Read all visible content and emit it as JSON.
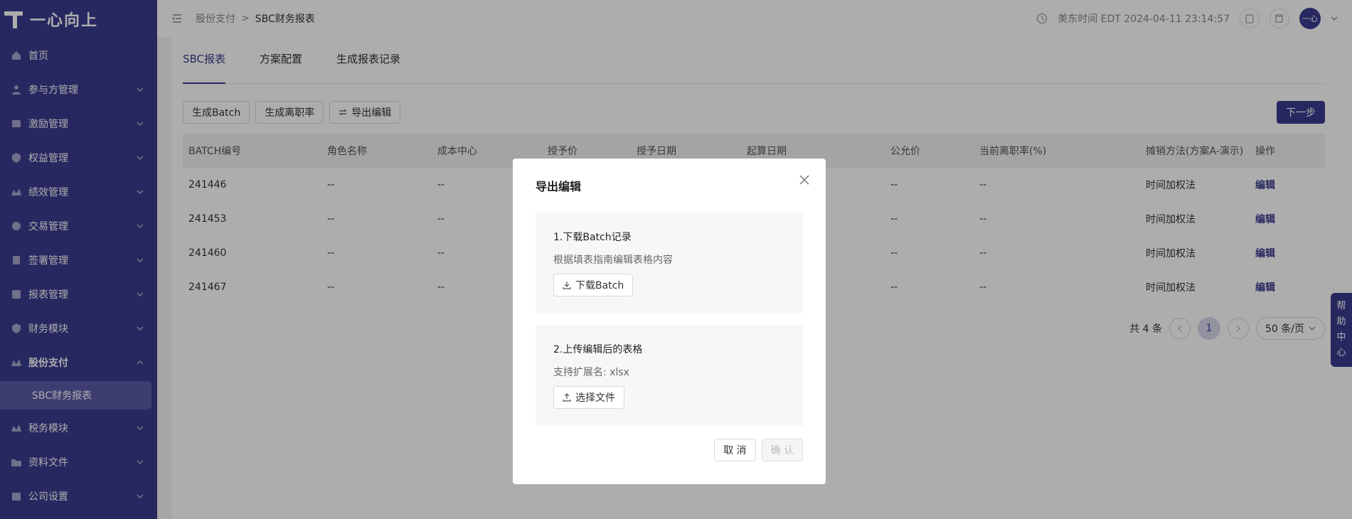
{
  "app": {
    "logo_text": "一心向上"
  },
  "sidebar": {
    "items": [
      {
        "label": "首页"
      },
      {
        "label": "参与方管理"
      },
      {
        "label": "激励管理"
      },
      {
        "label": "权益管理"
      },
      {
        "label": "绩效管理"
      },
      {
        "label": "交易管理"
      },
      {
        "label": "签署管理"
      },
      {
        "label": "报表管理"
      },
      {
        "label": "财务模块"
      },
      {
        "label": "股份支付"
      },
      {
        "label": "税务模块"
      },
      {
        "label": "资料文件"
      },
      {
        "label": "公司设置"
      }
    ],
    "sub_active": "SBC财务报表"
  },
  "header": {
    "breadcrumb_parent": "股份支付",
    "breadcrumb_sep": ">",
    "breadcrumb_current": "SBC财务报表",
    "time_text": "美东时间 EDT 2024-04-11 23:14:57",
    "avatar_text": "一心"
  },
  "tabs": [
    {
      "label": "SBC报表",
      "active": true
    },
    {
      "label": "方案配置",
      "active": false
    },
    {
      "label": "生成报表记录",
      "active": false
    }
  ],
  "toolbar": {
    "gen_batch": "生成Batch",
    "gen_rate": "生成离职率",
    "export_edit": "导出编辑",
    "next": "下一步"
  },
  "table": {
    "columns": [
      "BATCH编号",
      "角色名称",
      "成本中心",
      "授予价",
      "授予日期",
      "起算日期",
      "公允价",
      "当前离职率(%)",
      "摊销方法(方案A-演示)",
      "操作"
    ],
    "rows": [
      {
        "batch": "241446",
        "role": "--",
        "cost": "--",
        "fair": "--",
        "rate": "--",
        "method": "时间加权法",
        "action": "编辑"
      },
      {
        "batch": "241453",
        "role": "--",
        "cost": "--",
        "fair": "--",
        "rate": "--",
        "method": "时间加权法",
        "action": "编辑"
      },
      {
        "batch": "241460",
        "role": "--",
        "cost": "--",
        "fair": "--",
        "rate": "--",
        "method": "时间加权法",
        "action": "编辑"
      },
      {
        "batch": "241467",
        "role": "--",
        "cost": "--",
        "fair": "--",
        "rate": "--",
        "method": "时间加权法",
        "action": "编辑"
      }
    ]
  },
  "pager": {
    "total": "共 4 条",
    "current": "1",
    "size": "50 条/页"
  },
  "help": {
    "chars": [
      "帮",
      "助",
      "中",
      "心"
    ]
  },
  "dialog": {
    "title": "导出编辑",
    "step1_title": "1.下载Batch记录",
    "step1_desc": "根据填表指南编辑表格内容",
    "step1_btn": "下载Batch",
    "step2_title": "2.上传编辑后的表格",
    "step2_desc": "支持扩展名: xlsx",
    "step2_btn": "选择文件",
    "cancel": "取 消",
    "confirm": "确 认"
  },
  "colors": {
    "brand": "#3b3b8f"
  }
}
